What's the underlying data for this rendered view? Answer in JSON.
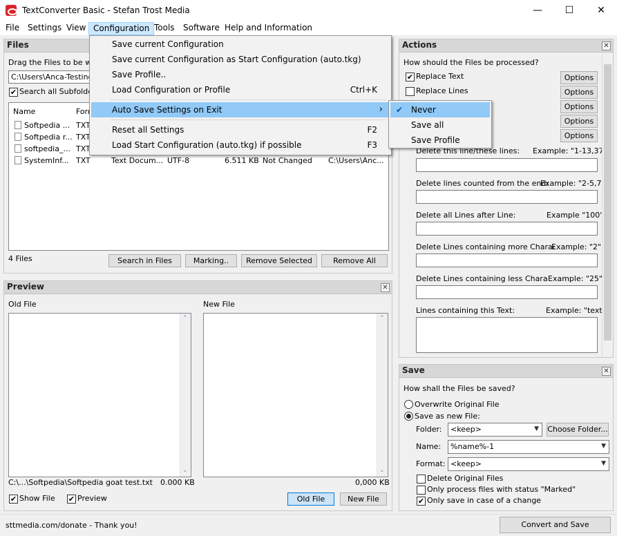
{
  "window": {
    "title": "TextConverter Basic - Stefan Trost Media",
    "minimize": "—",
    "maximize": "☐",
    "close": "✕"
  },
  "menubar": [
    "File",
    "Settings",
    "View",
    "Configuration",
    "Tools",
    "Software",
    "Help and Information"
  ],
  "configuration_menu": {
    "items": [
      {
        "label": "Save current Configuration",
        "shortcut": ""
      },
      {
        "label": "Save current Configuration as Start Configuration (auto.tkg)",
        "shortcut": ""
      },
      {
        "label": "Save Profile..",
        "shortcut": ""
      },
      {
        "label": "Load Configuration or Profile",
        "shortcut": "Ctrl+K"
      },
      {
        "label": "Auto Save Settings on Exit",
        "shortcut": "›"
      },
      {
        "label": "Reset all Settings",
        "shortcut": "F2"
      },
      {
        "label": "Load Start Configuration (auto.tkg) if possible",
        "shortcut": "F3"
      }
    ]
  },
  "autosave_submenu": {
    "items": [
      "Never",
      "Save all",
      "Save Profile"
    ],
    "check": "✔"
  },
  "files_panel": {
    "title": "Files",
    "drag_hint": "Drag the Files to be worl",
    "path": "C:\\Users\\Anca-Testing\\",
    "search_sub": "Search all Subfolders",
    "columns": [
      "Name",
      "Forr"
    ],
    "rows": [
      {
        "name": "Softpedia ...",
        "fmt": "TXT"
      },
      {
        "name": "Softpedia r...",
        "fmt": "TXT"
      },
      {
        "name": "softpedia_...",
        "fmt": "TXT"
      },
      {
        "name": "SystemInf...",
        "fmt": "TXT",
        "type": "Text Docum...",
        "enc": "UTF-8",
        "size": "6.511 KB",
        "status": "Not Changed",
        "path": "C:\\Users\\Anc..."
      }
    ],
    "count": "4 Files",
    "buttons": [
      "Search in Files",
      "Marking..",
      "Remove Selected",
      "Remove All"
    ]
  },
  "preview_panel": {
    "title": "Preview",
    "old_label": "Old File",
    "new_label": "New File",
    "old_path": "C:\\...\\Softpedia\\Softpedia goat test.txt",
    "old_size": "0.000 KB",
    "new_size": "0,000 KB",
    "show_file": "Show File",
    "preview": "Preview",
    "btn_old": "Old File",
    "btn_new": "New File"
  },
  "actions_panel": {
    "title": "Actions",
    "question": "How should the Files be processed?",
    "checks": [
      "Replace Text",
      "Replace Lines"
    ],
    "options": "Options",
    "fields": [
      {
        "label": "Delete this line/these lines:",
        "example": "Example: \"1-13,37\""
      },
      {
        "label": "Delete lines counted from the end:",
        "example": "Example: \"2-5,7\""
      },
      {
        "label": "Delete all Lines after Line:",
        "example": "Example \"100\""
      },
      {
        "label": "Delete Lines containing more Characters than:",
        "example": "Example: \"2\""
      },
      {
        "label": "Delete Lines containing less Characters than:",
        "example": "Example: \"25\""
      },
      {
        "label": "Lines containing this Text:",
        "example": "Example: \"text\""
      }
    ]
  },
  "save_panel": {
    "title": "Save",
    "question": "How shall the Files be saved?",
    "overwrite": "Overwrite Original File",
    "save_new": "Save as new File:",
    "folder_label": "Folder:",
    "folder_value": "<keep>",
    "choose_folder": "Choose Folder...",
    "name_label": "Name:",
    "name_value": "%name%-1",
    "format_label": "Format:",
    "format_value": "<keep>",
    "checks": [
      "Delete Original Files",
      "Only process files with status \"Marked\"",
      "Only save in case of a change"
    ]
  },
  "statusbar": {
    "text": "sttmedia.com/donate - Thank you!",
    "convert": "Convert and Save"
  },
  "icons": {
    "down": "⌄",
    "up": "⌃",
    "checkmark": "✔",
    "arrow_down": "▼"
  },
  "colors": {
    "menu_highlight": "#91c9f7",
    "panel_header": "#d7d7d7",
    "accent": "#0078d7"
  }
}
